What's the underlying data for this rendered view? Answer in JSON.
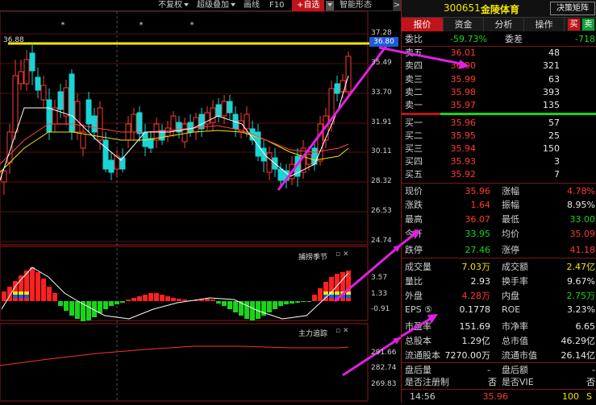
{
  "toolbar": {
    "fuquan": "不复权",
    "overlay": "超级叠加",
    "draw": "画线",
    "f10": "F10",
    "add_watch": "+自选",
    "smart": "智能形态"
  },
  "stock": {
    "code": "300651",
    "name": "金陵体育",
    "decision": "决策矩阵"
  },
  "tabs": [
    "报价",
    "资金",
    "分析",
    "操作"
  ],
  "buy_icon": "买",
  "sell_icon": "卖",
  "weibi": {
    "label1": "委比",
    "value1": "-59.73%",
    "label2": "委差",
    "value2": "-718"
  },
  "asks": [
    {
      "label": "卖五",
      "price": "36.01",
      "vol": "48"
    },
    {
      "label": "卖四",
      "price": "36.00",
      "vol": "321"
    },
    {
      "label": "卖三",
      "price": "35.99",
      "vol": "63"
    },
    {
      "label": "卖二",
      "price": "35.98",
      "vol": "393"
    },
    {
      "label": "卖一",
      "price": "35.97",
      "vol": "135"
    }
  ],
  "bids": [
    {
      "label": "买一",
      "price": "35.96",
      "vol": "57"
    },
    {
      "label": "买二",
      "price": "35.95",
      "vol": "25"
    },
    {
      "label": "买三",
      "price": "35.94",
      "vol": "150"
    },
    {
      "label": "买四",
      "price": "35.93",
      "vol": "3"
    },
    {
      "label": "买五",
      "price": "35.92",
      "vol": "7"
    }
  ],
  "quote": {
    "xianjia_l": "现价",
    "xianjia": "35.96",
    "zhangfu_l": "涨幅",
    "zhangfu": "4.78%",
    "zhangdie_l": "涨跌",
    "zhangdie": "1.64",
    "zhenfu_l": "振幅",
    "zhenfu": "8.95%",
    "zuigao_l": "最高",
    "zuigao": "36.07",
    "zuidi_l": "最低",
    "zuidi": "33.00",
    "jinkai_l": "今开",
    "jinkai": "33.95",
    "junjia_l": "均价",
    "junjia": "35.09",
    "dieting_l": "跌停",
    "dieting": "27.46",
    "zhangting_l": "涨停",
    "zhangting": "41.18",
    "cjl_l": "成交量",
    "cjl": "7.03万",
    "cje_l": "成交额",
    "cje": "2.47亿",
    "liangbi_l": "量比",
    "liangbi": "2.93",
    "hsl_l": "换手率",
    "hsl": "9.67%",
    "waipan_l": "外盘",
    "waipan": "4.28万",
    "neipan_l": "内盘",
    "neipan": "2.75万",
    "eps_l": "EPS ⑤",
    "eps": "0.1778",
    "roe_l": "ROE",
    "roe": "3.23%",
    "syl_l": "市盈率",
    "syl": "151.69",
    "sjl_l": "市净率",
    "sjl": "6.65",
    "zgb_l": "总股本",
    "zgb": "1.29亿",
    "zsz_l": "总市值",
    "zsz": "46.29亿",
    "ltgb_l": "流通股本",
    "ltgb": "7270.00万",
    "ltsz_l": "流通市值",
    "ltsz": "26.14亿",
    "phl_l": "盘后量",
    "phl": "-",
    "phe_l": "盘后额",
    "phe": "-",
    "zcz_l": "是否注册制",
    "zcz": "否",
    "vie_l": "是否VIE",
    "vie": "否"
  },
  "tick": {
    "time": "14:56",
    "price": "35.96",
    "vol": "100",
    "flag": "S"
  },
  "chart": {
    "price_axis": [
      "37.28",
      "35.49",
      "33.70",
      "31.91",
      "30.11",
      "28.32",
      "26.53",
      "24.74"
    ],
    "hi_label": "36.88",
    "price_tag": "36.80",
    "ind1_title": "捕捞季节",
    "ind1_axis": [
      "3.57",
      "1.33",
      "-0.91"
    ],
    "ind2_title": "主力追踪",
    "ind2_axis": [
      "291.66",
      "282.74",
      "269.83"
    ]
  },
  "colors": {
    "up": "#ff3b30",
    "down": "#19d4d4",
    "ma5": "#ffffff",
    "ma10": "#f3e600",
    "ma20": "#ff4444",
    "arrow": "#e020e0"
  }
}
